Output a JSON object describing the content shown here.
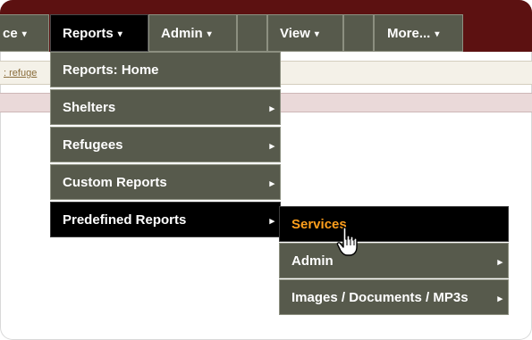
{
  "menubar": {
    "items": [
      {
        "label": "ce",
        "arrow": "▾"
      },
      {
        "label": "Reports",
        "arrow": "▾"
      },
      {
        "label": "Admin",
        "arrow": "▾"
      },
      {
        "label": ""
      },
      {
        "label": "View",
        "arrow": "▾"
      },
      {
        "label": ""
      },
      {
        "label": "More...",
        "arrow": "▾"
      }
    ]
  },
  "breadcrumb": {
    "prefix": ":",
    "link": "refuge"
  },
  "reports_menu": {
    "items": [
      {
        "label": "Reports: Home"
      },
      {
        "label": "Shelters",
        "submenu": "▸"
      },
      {
        "label": "Refugees",
        "submenu": "▸"
      },
      {
        "label": "Custom Reports",
        "submenu": "▸"
      },
      {
        "label": "Predefined Reports",
        "submenu": "▸"
      }
    ]
  },
  "predefined_menu": {
    "items": [
      {
        "label": "Services"
      },
      {
        "label": "Admin",
        "submenu": "▸"
      },
      {
        "label": "Images / Documents / MP3s",
        "submenu": "▸"
      }
    ]
  },
  "colors": {
    "menubar_bg": "#5c1111",
    "menu_bg": "#575a4c",
    "menu_active_bg": "#000000",
    "hover_text": "#ff9f1c"
  }
}
